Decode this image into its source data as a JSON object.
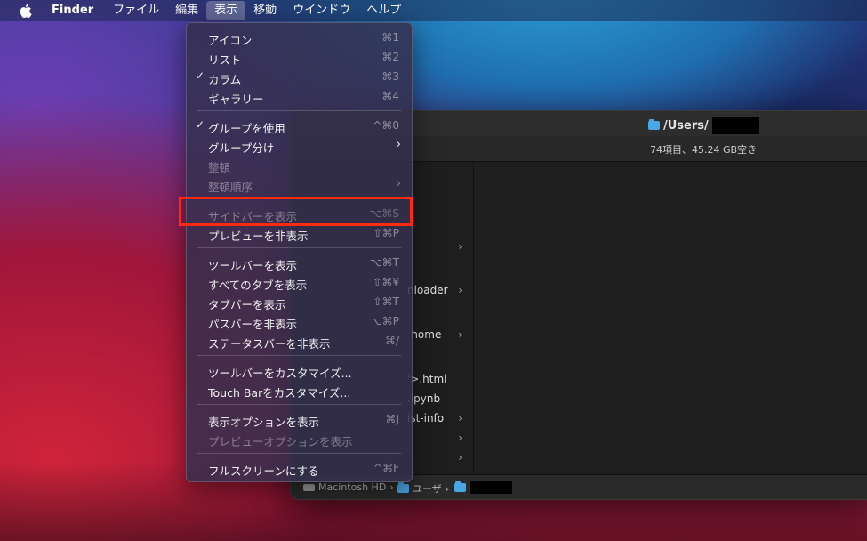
{
  "menubar": {
    "app_name": "Finder",
    "items": [
      "ファイル",
      "編集",
      "表示",
      "移動",
      "ウインドウ",
      "ヘルプ"
    ],
    "active_index": 2
  },
  "finder_window": {
    "title": "/Users/",
    "status": "74項目、45.24 GB空き",
    "column_rows": [
      {
        "text": "",
        "chevron": true
      },
      {
        "text": "nloader",
        "chevron": true
      },
      {
        "text": "-home",
        "chevron": true
      },
      {
        "text": "'>.html",
        "chevron": false
      },
      {
        "text": ".ipynb",
        "chevron": false
      },
      {
        "text": "ist-info",
        "chevron": true
      },
      {
        "text": "",
        "chevron": true
      },
      {
        "text": "",
        "chevron": true
      }
    ],
    "pathbar": {
      "disk": "Macintosh HD",
      "users": "ユーザ",
      "sep": "›"
    }
  },
  "view_menu": {
    "items": [
      {
        "label": "アイコン",
        "shortcut": "⌘1",
        "checked": false,
        "disabled": false
      },
      {
        "label": "リスト",
        "shortcut": "⌘2",
        "checked": false,
        "disabled": false
      },
      {
        "label": "カラム",
        "shortcut": "⌘3",
        "checked": true,
        "disabled": false
      },
      {
        "label": "ギャラリー",
        "shortcut": "⌘4",
        "checked": false,
        "disabled": false
      },
      {
        "label": "グループを使用",
        "shortcut": "^⌘0",
        "checked": true,
        "disabled": false
      },
      {
        "label": "グループ分け",
        "shortcut": "",
        "checked": false,
        "disabled": false,
        "submenu": true
      },
      {
        "label": "整頓",
        "shortcut": "",
        "checked": false,
        "disabled": true
      },
      {
        "label": "整頓順序",
        "shortcut": "",
        "checked": false,
        "disabled": true,
        "submenu": true
      },
      {
        "label": "サイドバーを表示",
        "shortcut": "⌥⌘S",
        "checked": false,
        "disabled": true
      },
      {
        "label": "プレビューを非表示",
        "shortcut": "⇧⌘P",
        "checked": false,
        "disabled": false
      },
      {
        "label": "ツールバーを表示",
        "shortcut": "⌥⌘T",
        "checked": false,
        "disabled": false
      },
      {
        "label": "すべてのタブを表示",
        "shortcut": "⇧⌘¥",
        "checked": false,
        "disabled": false
      },
      {
        "label": "タブバーを表示",
        "shortcut": "⇧⌘T",
        "checked": false,
        "disabled": false
      },
      {
        "label": "パスバーを非表示",
        "shortcut": "⌥⌘P",
        "checked": false,
        "disabled": false
      },
      {
        "label": "ステータスバーを非表示",
        "shortcut": "⌘/",
        "checked": false,
        "disabled": false
      },
      {
        "label": "ツールバーをカスタマイズ...",
        "shortcut": "",
        "checked": false,
        "disabled": false
      },
      {
        "label": "Touch Barをカスタマイズ...",
        "shortcut": "",
        "checked": false,
        "disabled": false
      },
      {
        "label": "表示オプションを表示",
        "shortcut": "⌘J",
        "checked": false,
        "disabled": false
      },
      {
        "label": "プレビューオプションを表示",
        "shortcut": "",
        "checked": false,
        "disabled": true
      },
      {
        "label": "フルスクリーンにする",
        "shortcut": "^⌘F",
        "checked": false,
        "disabled": false
      }
    ],
    "check_glyph": "✓",
    "submenu_glyph": "›"
  },
  "colors": {
    "highlight_box": "#ff2a12",
    "folder": "#4aa7e6"
  }
}
